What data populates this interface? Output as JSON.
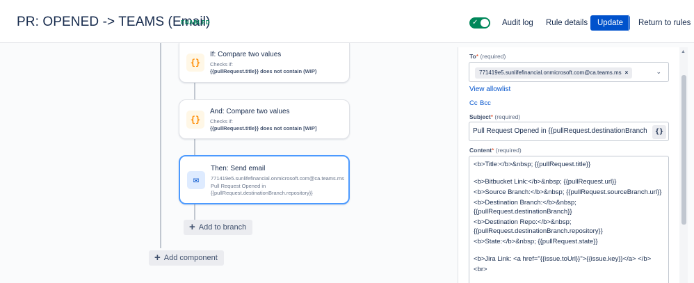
{
  "header": {
    "rule_title": "PR: OPENED -> TEAMS (Email)",
    "status": "ENABLED",
    "toggle_on": true,
    "toggle_check": "✓",
    "audit_log": "Audit log",
    "rule_details": "Rule details",
    "update": "Update",
    "return_to_rules": "Return to rules"
  },
  "flow": {
    "nodes": [
      {
        "icon": "braces-icon",
        "icon_glyph": "{}",
        "title": "If: Compare two values",
        "line1": "Checks if:",
        "line2": "{{pullRequest.title}} does not contain (WIP)"
      },
      {
        "icon": "braces-icon",
        "icon_glyph": "{}",
        "title": "And: Compare two values",
        "line1": "Checks if:",
        "line2": "{{pullRequest.title}} does not contain [WIP]"
      },
      {
        "icon": "mail-icon",
        "icon_glyph": "✉",
        "title": "Then: Send email",
        "line1": "771419e5.sunlifefinancial.onmicrosoft.com@ca.teams.ms",
        "line2": "Pull Request Opened in",
        "line3": "{{pullRequest.destinationBranch.repository}}"
      }
    ],
    "add_to_branch": "Add to branch",
    "add_component": "Add component",
    "plus": "+"
  },
  "panel": {
    "to_label": "To",
    "required_star": "*",
    "required_text": "(required)",
    "to_chip": "771419e5.sunlifefinancial.onmicrosoft.com@ca.teams.ms",
    "chip_remove": "×",
    "chevron": "⌄",
    "view_allowlist": "View allowlist",
    "cc": "Cc",
    "bcc": "Bcc",
    "subject_label": "Subject",
    "subject_value": "Pull Request Opened in {{pullRequest.destinationBranch.rep",
    "smart_value_glyph": "{}",
    "content_label": "Content",
    "content_lines": [
      "<b>Title:</b>&nbsp;  {{pullRequest.title}}",
      "",
      "<b>Bitbucket Link:</b>&nbsp;  {{pullRequest.url}}",
      "<b>Source Branch:</b>&nbsp;  {{pullRequest.sourceBranch.url}}",
      "<b>Destination Branch:</b>&nbsp;",
      "{{pullRequest.destinationBranch}}",
      "<b>Destination Repo:</b>&nbsp;",
      "{{pullRequest.destinationBranch.repository}}",
      "<b>State:</b>&nbsp;  {{pullRequest.state}}",
      "",
      "<b>Jira Link: <a href=\"{{issue.toUrl}}\">{{issue.key}}</a> </b>",
      "<br>"
    ]
  },
  "colors": {
    "primary": "#0052cc",
    "success": "#00875a",
    "selected_border": "#4c9aff",
    "required": "#de350b"
  }
}
